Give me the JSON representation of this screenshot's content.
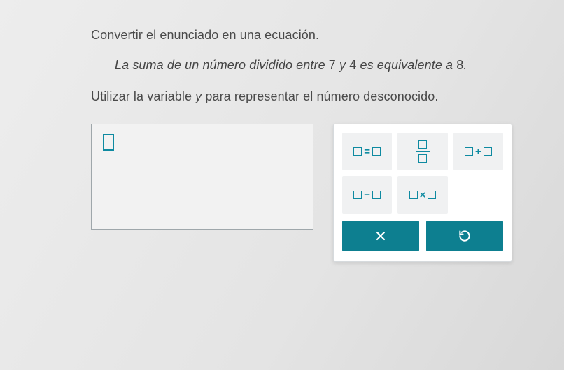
{
  "instruction": "Convertir el enunciado en una ecuación.",
  "problem": {
    "prefix": "La suma de un número dividido entre ",
    "num1": "7",
    "mid1": " y ",
    "num2": "4",
    "mid2": " es equivalente a ",
    "num3": "8",
    "suffix": "."
  },
  "variable_instruction": {
    "prefix": "Utilizar la variable ",
    "var": "y",
    "suffix": " para representar el número desconocido."
  },
  "palette": {
    "equals": "=",
    "plus": "+",
    "minus": "−",
    "times": "×"
  },
  "actions": {
    "clear": "×",
    "reset": "↺"
  }
}
